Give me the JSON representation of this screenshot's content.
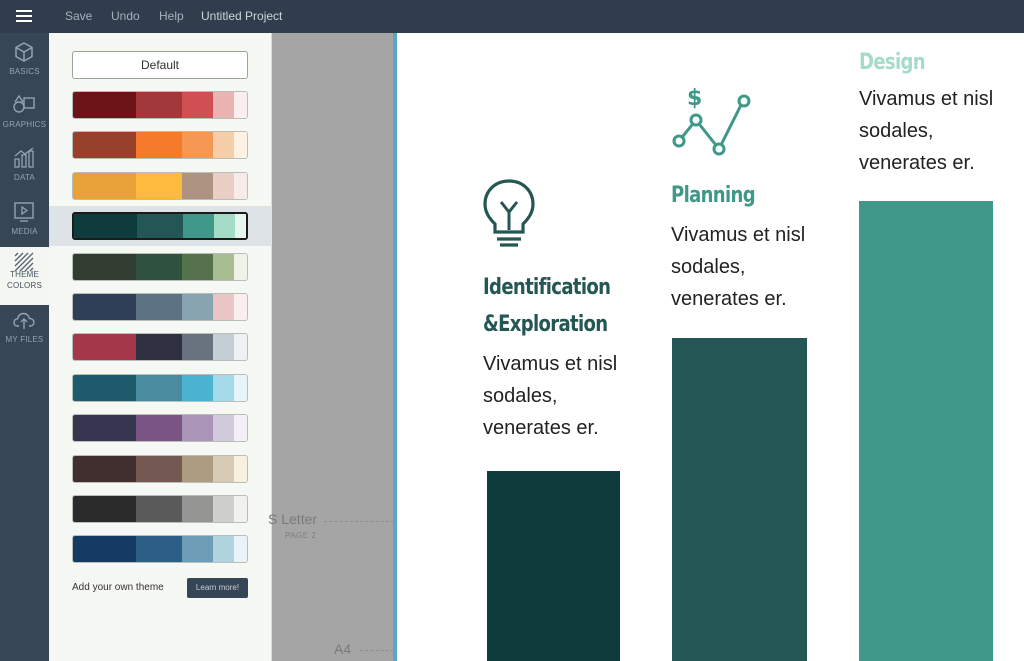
{
  "toolbar": {
    "save": "Save",
    "undo": "Undo",
    "help": "Help",
    "project_title": "Untitled Project"
  },
  "rail": [
    {
      "label": "BASICS",
      "icon": "cube-icon"
    },
    {
      "label": "GRAPHICS",
      "icon": "shapes-icon"
    },
    {
      "label": "DATA",
      "icon": "chart-icon"
    },
    {
      "label": "MEDIA",
      "icon": "play-icon"
    },
    {
      "label1": "THEME",
      "label2": "COLORS",
      "icon": "stripes-icon",
      "active": true
    },
    {
      "label": "MY FILES",
      "icon": "cloud-upload-icon"
    }
  ],
  "panel": {
    "default_label": "Default",
    "add_theme_label": "Add your own theme",
    "learn_more_label": "Learn more!",
    "palettes": [
      [
        "#6b1518",
        "#a3383a",
        "#cf4f52",
        "#eab4b3",
        "#fbeeee"
      ],
      [
        "#98412a",
        "#f57a2b",
        "#f59854",
        "#f6cfa8",
        "#fdf2e3"
      ],
      [
        "#e7a238",
        "#fdbb3e",
        "#ad9380",
        "#e9cfc5",
        "#f8ecea"
      ],
      [
        "#0e3b3b",
        "#245653",
        "#3f9888",
        "#a5dcc8",
        "#e6f6ef"
      ],
      [
        "#313d31",
        "#2f5240",
        "#56724c",
        "#a8be92",
        "#eef2e8"
      ],
      [
        "#2e3f57",
        "#5d7282",
        "#88a4b0",
        "#ebc5c3",
        "#faeeee"
      ],
      [
        "#a4384a",
        "#2e3041",
        "#69737f",
        "#c3cfd5",
        "#eef2f4"
      ],
      [
        "#1e5b6d",
        "#4a8ba0",
        "#4bb3d1",
        "#a5d9ea",
        "#e6f4fa"
      ],
      [
        "#363550",
        "#7b5486",
        "#aa94b8",
        "#d0cadc",
        "#f2f0f6"
      ],
      [
        "#402f2e",
        "#745852",
        "#ad9b82",
        "#d7cbb5",
        "#f8f1df"
      ],
      [
        "#2b2b2b",
        "#5a5a5a",
        "#959594",
        "#cfcfcd",
        "#f1f1ef"
      ],
      [
        "#153a64",
        "#2c5f86",
        "#6e9db7",
        "#b1d2df",
        "#e9f3f8"
      ]
    ],
    "selected_index": 3
  },
  "workspace": {
    "letter_label": "S Letter",
    "page_label": "PAGE 2",
    "a4_label": "A4"
  },
  "document": {
    "columns": [
      {
        "title_line1": "Identification",
        "title_line2": "&Exploration",
        "body_line1": "Vivamus et nisl",
        "body_line2": "sodales,",
        "body_line3": "venerates er.",
        "title_color": "#245653",
        "bar_color": "#0e3b3b",
        "icon": "lightbulb-icon"
      },
      {
        "title_line1": "Planning",
        "body_line1": "Vivamus et nisl",
        "body_line2": "sodales,",
        "body_line3": "venerates er.",
        "title_color": "#3f9888",
        "bar_color": "#245653",
        "icon": "growth-chart-icon"
      },
      {
        "title_line1": "Design",
        "body_line1": "Vivamus et nisl",
        "body_line2": "sodales,",
        "body_line3": "venerates er.",
        "title_color": "#a5dcc8",
        "bar_color": "#3f9888"
      }
    ]
  }
}
